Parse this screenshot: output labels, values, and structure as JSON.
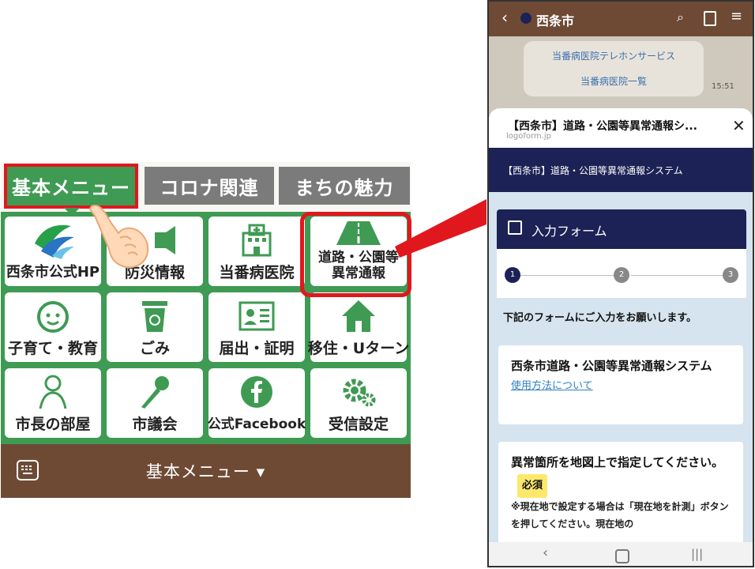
{
  "rich_menu": {
    "tabs": [
      "基本メニュー",
      "コロナ関連",
      "まちの魅力"
    ],
    "items": [
      {
        "label": "西条市公式HP",
        "icon": "city-logo-icon"
      },
      {
        "label": "防災情報",
        "icon": "megaphone-icon"
      },
      {
        "label": "当番病医院",
        "icon": "hospital-icon"
      },
      {
        "label": "道路・公園等異常通報",
        "icon": "road-icon"
      },
      {
        "label": "子育て・教育",
        "icon": "child-face-icon"
      },
      {
        "label": "ごみ",
        "icon": "recycle-bin-icon"
      },
      {
        "label": "届出・証明",
        "icon": "id-card-icon"
      },
      {
        "label": "移住・Uターン",
        "icon": "house-icon"
      },
      {
        "label": "市長の部屋",
        "icon": "person-icon"
      },
      {
        "label": "市議会",
        "icon": "microphone-icon"
      },
      {
        "label": "公式Facebook",
        "icon": "facebook-icon"
      },
      {
        "label": "受信設定",
        "icon": "gear-icon"
      }
    ],
    "bottom_bar_label": "基本メニュー ▾"
  },
  "phone": {
    "header_title": "西条市",
    "chat_bubble": {
      "line1": "当番病医院テレホンサービス",
      "line2": "当番病医院一覧",
      "time": "15:51"
    },
    "sheet": {
      "title": "【西条市】道路・公園等異常通報シ...",
      "domain": "logoform.jp",
      "banner": "【西条市】道路・公園等異常通報システム",
      "form_header": "入力フォーム",
      "steps": [
        "1",
        "2",
        "3"
      ],
      "instruction": "下記のフォームにご入力をお願いします。",
      "card1_title": "西条市道路・公園等異常通報システム",
      "card1_link": "使用方法について",
      "card2_title": "異常箇所を地図上で指定してください。",
      "card2_required": "必須",
      "card2_note": "※現在地で設定する場合は「現在地を計測」ボタンを押してください。現在地の"
    }
  },
  "colors": {
    "green": "#3f9a53",
    "brown": "#6e4a35",
    "red": "#e1171e",
    "navy": "#1c2255",
    "link": "#2d7fc1"
  }
}
